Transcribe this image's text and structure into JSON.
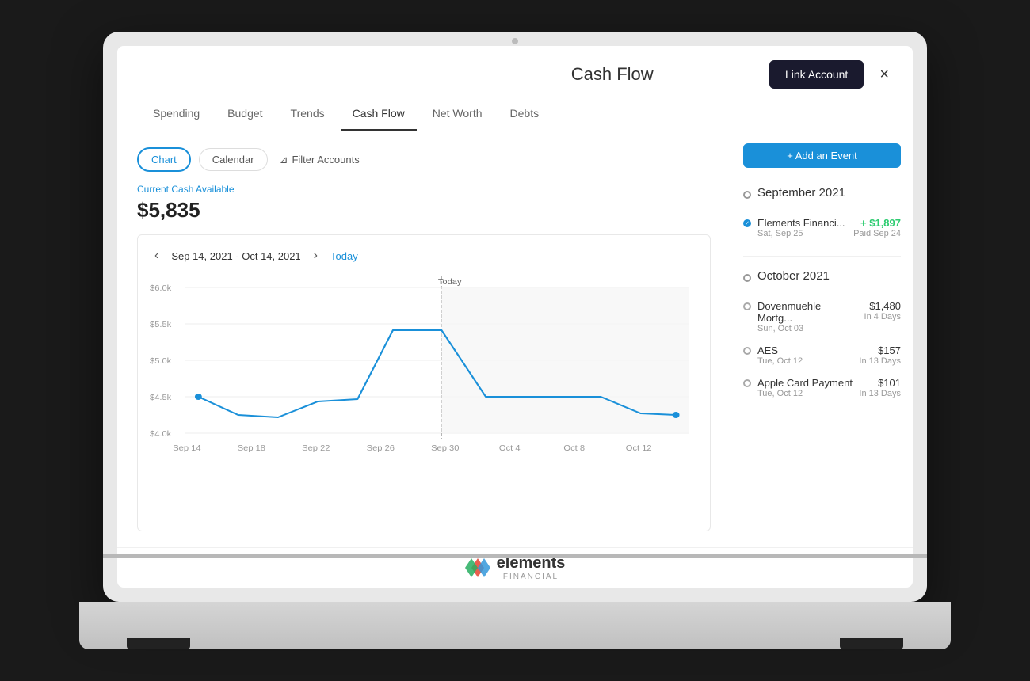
{
  "app": {
    "title": "Cash Flow",
    "close_label": "×"
  },
  "header": {
    "link_account_label": "Link Account"
  },
  "tabs": [
    {
      "label": "Spending",
      "active": false
    },
    {
      "label": "Budget",
      "active": false
    },
    {
      "label": "Trends",
      "active": false
    },
    {
      "label": "Cash Flow",
      "active": true
    },
    {
      "label": "Net Worth",
      "active": false
    },
    {
      "label": "Debts",
      "active": false
    }
  ],
  "sub_tabs": [
    {
      "label": "Chart",
      "active": true
    },
    {
      "label": "Calendar",
      "active": false
    }
  ],
  "filter_label": "Filter Accounts",
  "cash_available_label": "Current Cash Available",
  "cash_available_value": "$5,835",
  "date_range": "Sep 14, 2021 - Oct 14, 2021",
  "today_label": "Today",
  "chart": {
    "y_labels": [
      "$6.0k",
      "$5.5k",
      "$5.0k",
      "$4.5k",
      "$4.0k"
    ],
    "x_labels": [
      "Sep 14",
      "Sep 18",
      "Sep 22",
      "Sep 26",
      "Sep 30",
      "Oct 4",
      "Oct 8",
      "Oct 12"
    ],
    "today_label": "Today"
  },
  "add_event_label": "+ Add an Event",
  "sections": [
    {
      "title": "September 2021",
      "items": [
        {
          "name": "Elements Financi...",
          "date": "Sat, Sep 25",
          "amount": "+ $1,897",
          "amount_positive": true,
          "sub": "Paid Sep 24",
          "paid": true
        }
      ]
    },
    {
      "title": "October 2021",
      "items": [
        {
          "name": "Dovenmuehle Mortg...",
          "date": "Sun, Oct 03",
          "amount": "$1,480",
          "amount_positive": false,
          "sub": "In 4 Days",
          "paid": false
        },
        {
          "name": "AES",
          "date": "Tue, Oct 12",
          "amount": "$157",
          "amount_positive": false,
          "sub": "In 13 Days",
          "paid": false
        },
        {
          "name": "Apple Card Payment",
          "date": "Tue, Oct 12",
          "amount": "$101",
          "amount_positive": false,
          "sub": "In 13 Days",
          "paid": false
        }
      ]
    }
  ],
  "brand": {
    "name": "elements",
    "financial": "FINANCIAL"
  }
}
